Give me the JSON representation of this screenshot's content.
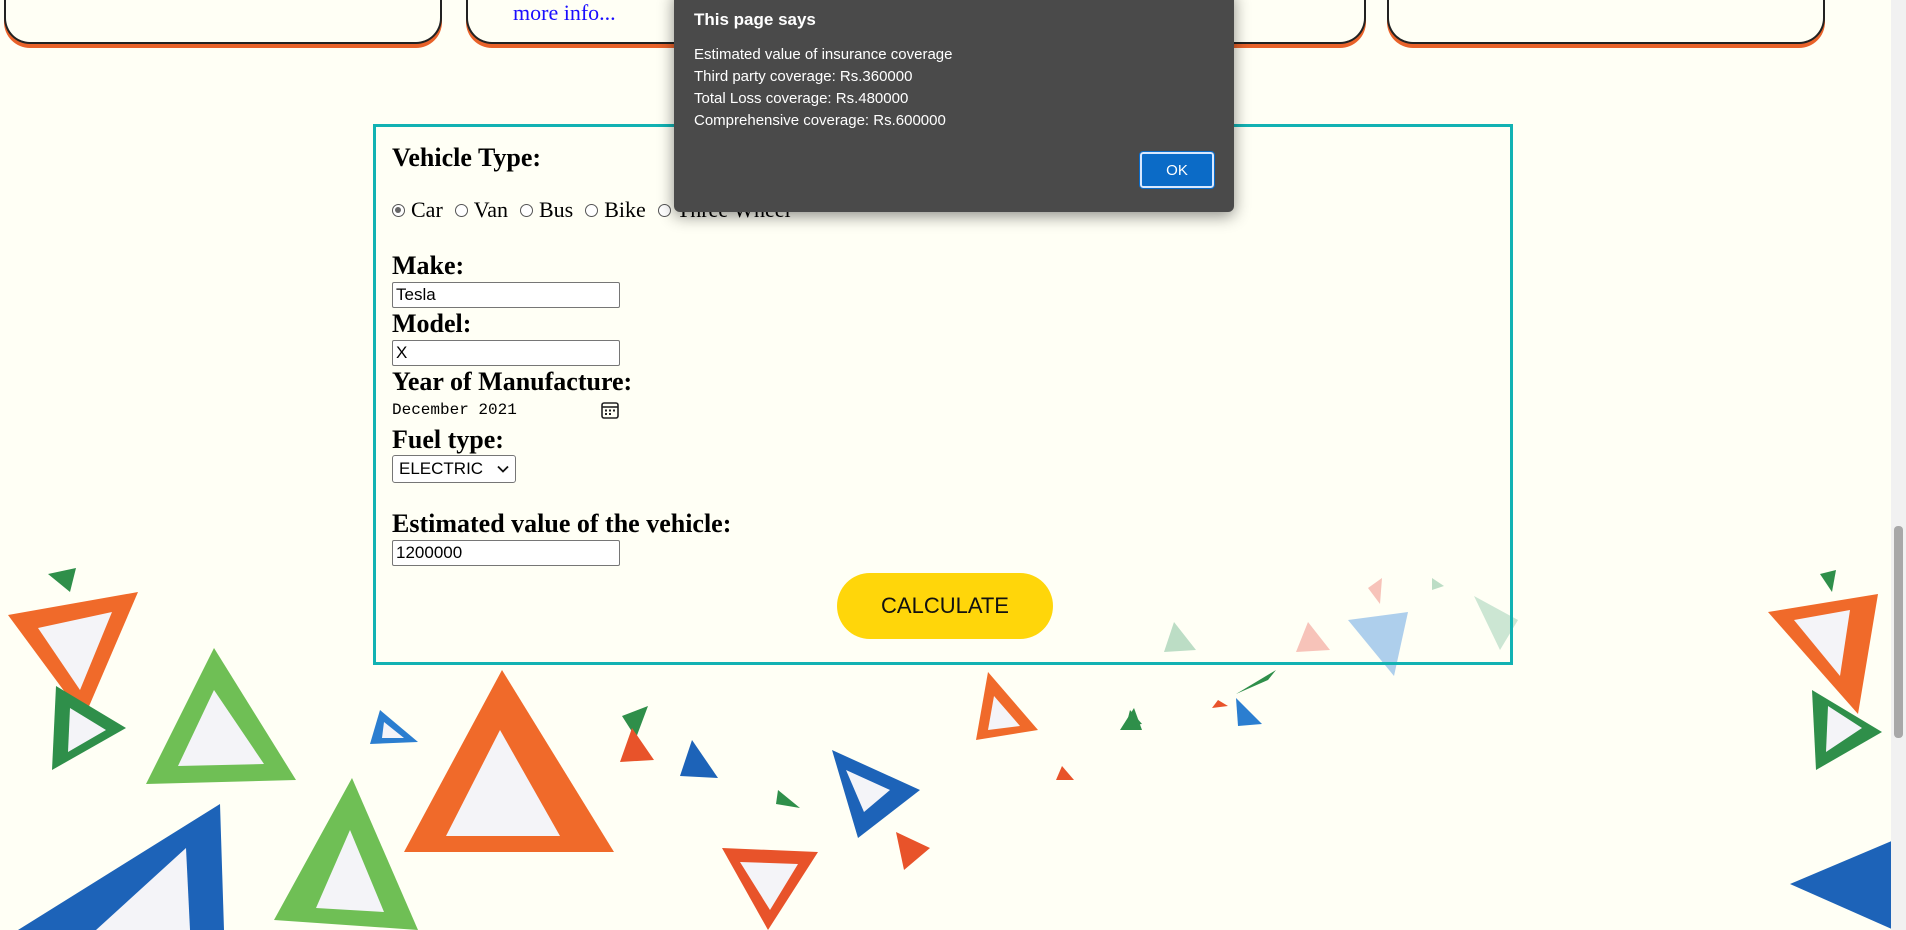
{
  "cards": {
    "more_info": "more info..."
  },
  "form": {
    "vehicle_type_label": "Vehicle Type:",
    "vehicle_types": [
      {
        "label": "Car",
        "checked": true
      },
      {
        "label": "Van",
        "checked": false
      },
      {
        "label": "Bus",
        "checked": false
      },
      {
        "label": "Bike",
        "checked": false
      },
      {
        "label": "Three Wheel",
        "checked": false
      }
    ],
    "make_label": "Make:",
    "make_value": "Tesla",
    "model_label": "Model:",
    "model_value": "X",
    "year_label": "Year of Manufacture:",
    "year_value": "December 2021",
    "fuel_label": "Fuel type:",
    "fuel_value": "ELECTRIC",
    "estimated_label": "Estimated value of the vehicle:",
    "estimated_value": "1200000",
    "calculate_label": "CALCULATE"
  },
  "dialog": {
    "title": "This page says",
    "lines": [
      "Estimated value of insurance coverage",
      "Third party coverage: Rs.360000",
      "Total Loss coverage: Rs.480000",
      "Comprehensive coverage: Rs.600000"
    ],
    "ok_label": "OK"
  },
  "colors": {
    "form_border": "#12b2b3",
    "calculate_bg": "#ffd60a",
    "dialog_bg": "#4a4a4a",
    "ok_bg": "#0b6bc7",
    "link": "#1a0dff"
  },
  "icons": {
    "date_picker": "calendar-icon",
    "select": "chevron-down-icon"
  }
}
